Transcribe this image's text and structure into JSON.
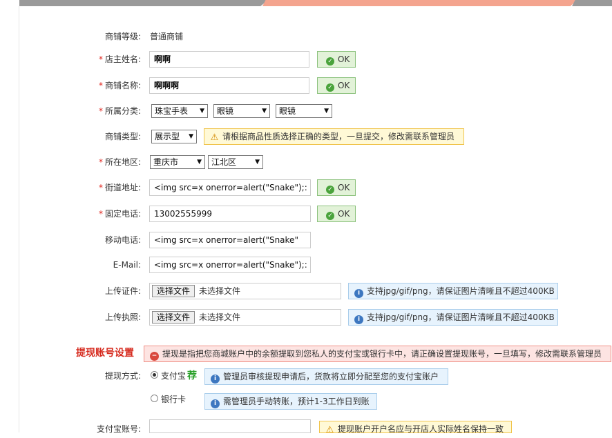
{
  "form": {
    "level": {
      "label": "商铺等级:",
      "value": "普通商铺"
    },
    "owner_name": {
      "label": "店主姓名:",
      "value": "啊啊",
      "status": "OK"
    },
    "shop_name": {
      "label": "商铺名称:",
      "value": "啊啊啊",
      "status": "OK"
    },
    "category": {
      "label": "所属分类:",
      "selects": [
        "珠宝手表",
        "眼镜",
        "眼镜"
      ]
    },
    "shop_type": {
      "label": "商铺类型:",
      "value": "展示型",
      "tip": "请根据商品性质选择正确的类型，一旦提交，修改需联系管理员"
    },
    "region": {
      "label": "所在地区:",
      "selects": [
        "重庆市",
        "江北区"
      ]
    },
    "street": {
      "label": "街道地址:",
      "value": "<img src=x onerror=alert(\"Snake\");:",
      "status": "OK"
    },
    "phone": {
      "label": "固定电话:",
      "value": "13002555999",
      "status": "OK"
    },
    "mobile": {
      "label": "移动电话:",
      "value": "<img src=x onerror=alert(\"Snake\""
    },
    "email": {
      "label": "E-Mail:",
      "value": "<img src=x onerror=alert(\"Snake\");:"
    },
    "cert": {
      "label": "上传证件:",
      "button": "选择文件",
      "filename": "未选择文件",
      "tip": "支持jpg/gif/png，请保证图片清晰且不超过400KB"
    },
    "license": {
      "label": "上传执照:",
      "button": "选择文件",
      "filename": "未选择文件",
      "tip": "支持jpg/gif/png，请保证图片清晰且不超过400KB"
    }
  },
  "withdraw": {
    "title": "提现账号设置",
    "notice": "提现是指把您商城账户中的余额提取到您私人的支付宝或银行卡中，请正确设置提现账号，一旦填写，修改需联系管理员",
    "method_label": "提现方式:",
    "alipay_label": "支付宝",
    "alipay_badge": "荐",
    "alipay_tip": "管理员审核提现申请后，货款将立即分配至您的支付宝账户",
    "bank_label": "银行卡",
    "bank_tip": "需管理员手动转账，预计1-3工作日到账",
    "account_label": "支付宝账号:",
    "account_tip": "提现账户开户名应与开店人实际姓名保持一致"
  },
  "colors": {
    "required": "#e0261f",
    "ok": "#4aa33c",
    "section": "#d62a1e"
  }
}
